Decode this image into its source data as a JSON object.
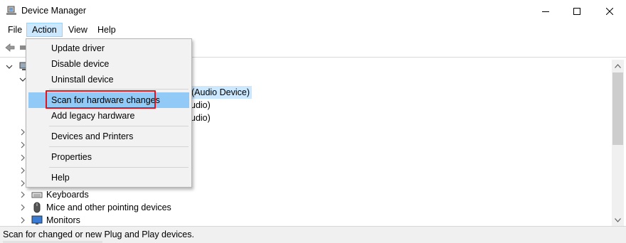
{
  "window": {
    "title": "Device Manager"
  },
  "menubar": {
    "file": "File",
    "action": "Action",
    "view": "View",
    "help": "Help"
  },
  "tree": {
    "audio_device_partial": "(Audio Device)",
    "audio_partial_1": "udio)",
    "audio_partial_2": "udio)",
    "keyboards": "Keyboards",
    "mice": "Mice and other pointing devices",
    "monitors": "Monitors"
  },
  "action_menu": {
    "update_driver": "Update driver",
    "disable_device": "Disable device",
    "uninstall_device": "Uninstall device",
    "scan_hardware": "Scan for hardware changes",
    "add_legacy": "Add legacy hardware",
    "devices_printers": "Devices and Printers",
    "properties": "Properties",
    "help": "Help"
  },
  "statusbar": {
    "text": "Scan for changed or new Plug and Play devices."
  },
  "colors": {
    "highlight": "#91c9f7",
    "selection": "#cce8ff",
    "annotation": "#e0141c"
  }
}
